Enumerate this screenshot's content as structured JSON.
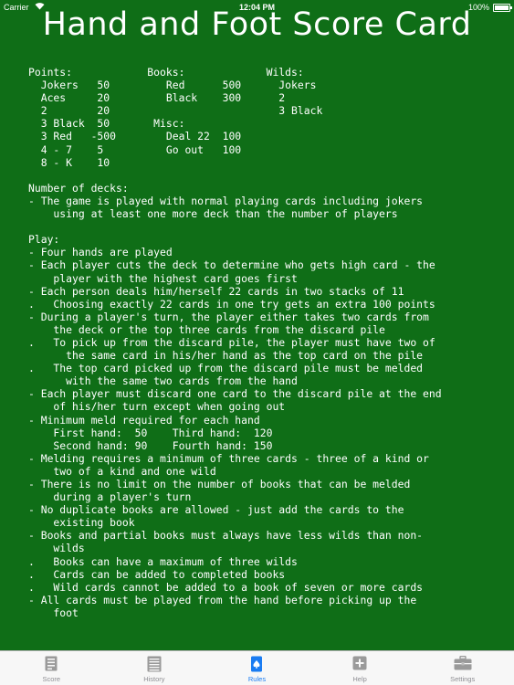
{
  "status_bar": {
    "carrier": "Carrier",
    "time": "12:04 PM",
    "battery": "100%"
  },
  "title": "Hand and Foot Score Card",
  "rules_lines": [
    "Points:            Books:             Wilds:",
    "  Jokers   50         Red      500      Jokers",
    "  Aces     20         Black    300      2",
    "  2        20                           3 Black",
    "  3 Black  50       Misc:",
    "  3 Red   -500        Deal 22  100",
    "  4 - 7    5          Go out   100",
    "  8 - K    10",
    "",
    "Number of decks:",
    "- The game is played with normal playing cards including jokers",
    "    using at least one more deck than the number of players",
    "",
    "Play:",
    "- Four hands are played",
    "- Each player cuts the deck to determine who gets high card - the",
    "    player with the highest card goes first",
    "- Each person deals him/herself 22 cards in two stacks of 11",
    ".   Choosing exactly 22 cards in one try gets an extra 100 points",
    "- During a player's turn, the player either takes two cards from",
    "    the deck or the top three cards from the discard pile",
    ".   To pick up from the discard pile, the player must have two of",
    "      the same card in his/her hand as the top card on the pile",
    ".   The top card picked up from the discard pile must be melded",
    "      with the same two cards from the hand",
    "- Each player must discard one card to the discard pile at the end",
    "    of his/her turn except when going out",
    "- Minimum meld required for each hand",
    "    First hand:  50    Third hand:  120",
    "    Second hand: 90    Fourth hand: 150",
    "- Melding requires a minimum of three cards - three of a kind or",
    "    two of a kind and one wild",
    "- There is no limit on the number of books that can be melded",
    "    during a player's turn",
    "- No duplicate books are allowed - just add the cards to the",
    "    existing book",
    "- Books and partial books must always have less wilds than non-",
    "    wilds",
    ".   Books can have a maximum of three wilds",
    ".   Cards can be added to completed books",
    ".   Wild cards cannot be added to a book of seven or more cards",
    "- All cards must be played from the hand before picking up the",
    "    foot"
  ],
  "tabs": [
    {
      "label": "Score",
      "icon": "score-icon",
      "active": false
    },
    {
      "label": "History",
      "icon": "history-icon",
      "active": false
    },
    {
      "label": "Rules",
      "icon": "rules-icon",
      "active": true
    },
    {
      "label": "Help",
      "icon": "help-icon",
      "active": false
    },
    {
      "label": "Settings",
      "icon": "settings-icon",
      "active": false
    }
  ],
  "colors": {
    "background": "#0f6e17",
    "text": "#ffffff",
    "tab_active": "#1a7cf2",
    "tab_inactive": "#8e8e93"
  }
}
